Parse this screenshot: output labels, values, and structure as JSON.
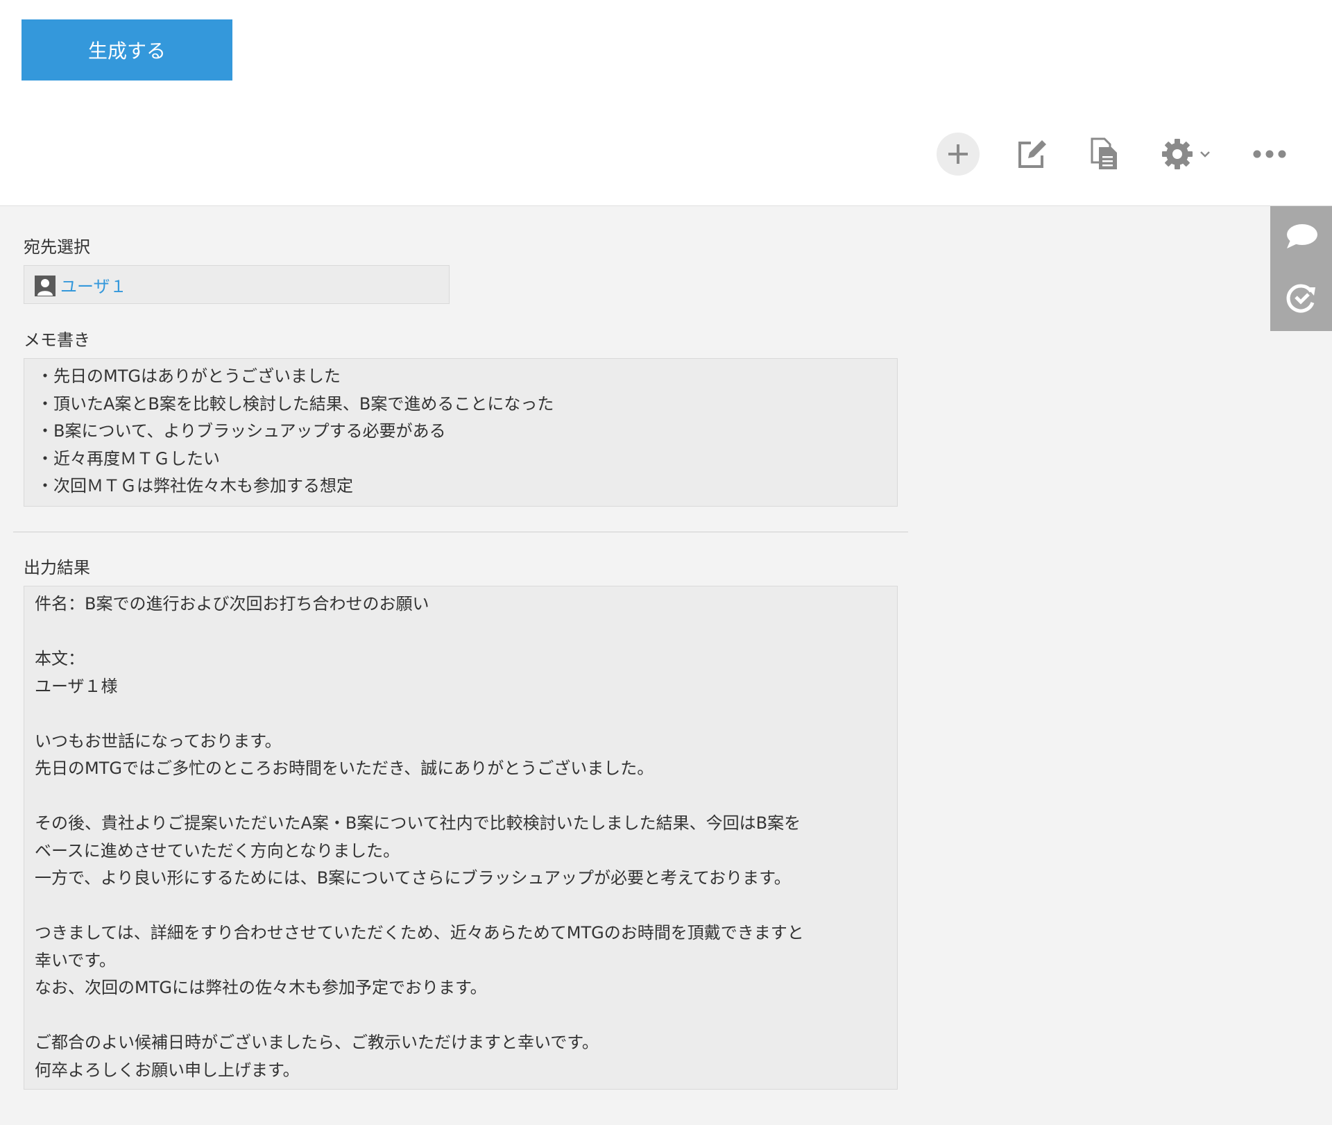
{
  "generate_button": {
    "label": "生成する"
  },
  "toolbar": {
    "add_icon": "plus-icon",
    "edit_icon": "edit-icon",
    "copy_icon": "copy-document-icon",
    "settings_icon": "gear-icon",
    "more_icon": "more-dots-icon"
  },
  "side_panel": {
    "comment_icon": "comment-bubble-icon",
    "history_icon": "history-icon"
  },
  "recipient": {
    "label": "宛先選択",
    "user_name": "ユーザ１"
  },
  "memo": {
    "label": "メモ書き",
    "lines": [
      "・先日のMTGはありがとうございました",
      "・頂いたA案とB案を比較し検討した結果、B案で進めることになった",
      "・B案について、よりブラッシュアップする必要がある",
      "・近々再度ＭＴＧしたい",
      "・次回ＭＴＧは弊社佐々木も参加する想定"
    ]
  },
  "output": {
    "label": "出力結果",
    "lines": [
      "件名：B案での進行および次回お打ち合わせのお願い",
      "",
      "本文：",
      "ユーザ１様",
      "",
      "いつもお世話になっております。",
      "先日のMTGではご多忙のところお時間をいただき、誠にありがとうございました。",
      "",
      "その後、貴社よりご提案いただいたA案・B案について社内で比較検討いたしました結果、今回はB案を",
      "ベースに進めさせていただく方向となりました。",
      "一方で、より良い形にするためには、B案についてさらにブラッシュアップが必要と考えております。",
      "",
      "つきましては、詳細をすり合わせさせていただくため、近々あらためてMTGのお時間を頂戴できますと",
      "幸いです。",
      "なお、次回のMTGには弊社の佐々木も参加予定でおります。",
      "",
      "ご都合のよい候補日時がございましたら、ご教示いただけますと幸いです。",
      "何卒よろしくお願い申し上げます。"
    ]
  },
  "colors": {
    "accent": "#3498db",
    "background": "#f3f3f3",
    "box": "#ececec",
    "side_panel": "#a8a8a8"
  }
}
